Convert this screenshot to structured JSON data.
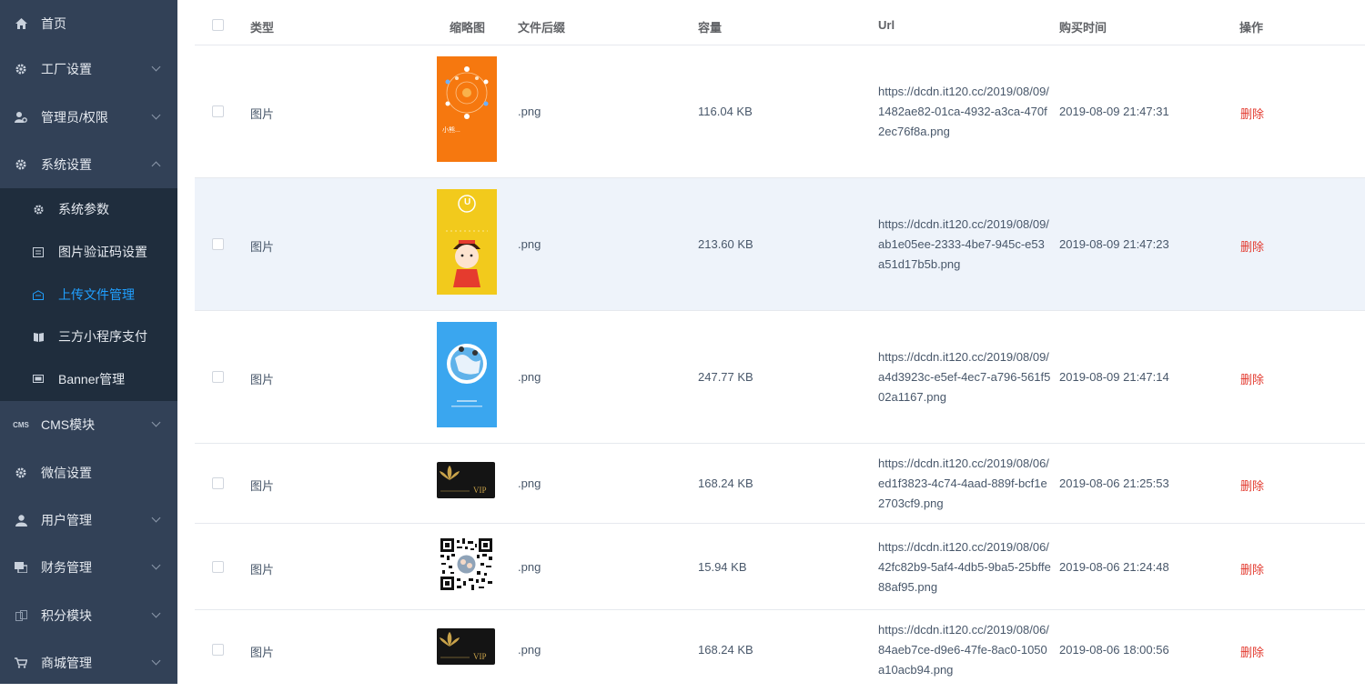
{
  "sidebar": {
    "items": [
      {
        "label": "首页",
        "icon": "home-icon"
      },
      {
        "label": "工厂设置",
        "icon": "gear-icon"
      },
      {
        "label": "管理员/权限",
        "icon": "admin-icon"
      },
      {
        "label": "系统设置",
        "icon": "gear-icon"
      },
      {
        "label": "CMS模块",
        "icon": "cms-icon"
      },
      {
        "label": "微信设置",
        "icon": "gear-icon"
      },
      {
        "label": "用户管理",
        "icon": "user-icon"
      },
      {
        "label": "财务管理",
        "icon": "finance-icon"
      },
      {
        "label": "积分模块",
        "icon": "points-icon"
      },
      {
        "label": "商城管理",
        "icon": "shop-icon"
      }
    ],
    "cms_icon_text": "CMS",
    "submenu": [
      {
        "label": "系统参数",
        "icon": "gear-icon"
      },
      {
        "label": "图片验证码设置",
        "icon": "captcha-icon"
      },
      {
        "label": "上传文件管理",
        "icon": "upload-icon",
        "active": true
      },
      {
        "label": "三方小程序支付",
        "icon": "book-icon"
      },
      {
        "label": "Banner管理",
        "icon": "banner-icon"
      }
    ]
  },
  "colors": {
    "sidebar_bg": "#324157",
    "submenu_bg": "#1f2d3d",
    "active": "#20a0ff",
    "delete": "#e33a2f"
  },
  "table": {
    "headers": {
      "type": "类型",
      "thumb": "缩略图",
      "ext": "文件后缀",
      "size": "容量",
      "url": "Url",
      "time": "购买时间",
      "action": "操作"
    },
    "rows": [
      {
        "type": "图片",
        "thumb": "orange-poster",
        "ext": ".png",
        "size": "116.04 KB",
        "url": "https://dcdn.it120.cc/2019/08/09/1482ae82-01ca-4932-a3ca-470f2ec76f8a.png",
        "time": "2019-08-09 21:47:31",
        "action": "删除",
        "thumb_text": "小熊..."
      },
      {
        "type": "图片",
        "thumb": "yellow-cartoon",
        "ext": ".png",
        "size": "213.60 KB",
        "url": "https://dcdn.it120.cc/2019/08/09/ab1e05ee-2333-4be7-945c-e53a51d17b5b.png",
        "time": "2019-08-09 21:47:23",
        "action": "删除",
        "thumb_text": "U"
      },
      {
        "type": "图片",
        "thumb": "blue-globe",
        "ext": ".png",
        "size": "247.77 KB",
        "url": "https://dcdn.it120.cc/2019/08/09/a4d3923c-e5ef-4ec7-a796-561f502a1167.png",
        "time": "2019-08-09 21:47:14",
        "action": "删除"
      },
      {
        "type": "图片",
        "thumb": "vip-card",
        "ext": ".png",
        "size": "168.24 KB",
        "url": "https://dcdn.it120.cc/2019/08/06/ed1f3823-4c74-4aad-889f-bcf1e2703cf9.png",
        "time": "2019-08-06 21:25:53",
        "action": "删除",
        "thumb_text": "VIP"
      },
      {
        "type": "图片",
        "thumb": "qr-code",
        "ext": ".png",
        "size": "15.94 KB",
        "url": "https://dcdn.it120.cc/2019/08/06/42fc82b9-5af4-4db5-9ba5-25bffe88af95.png",
        "time": "2019-08-06 21:24:48",
        "action": "删除"
      },
      {
        "type": "图片",
        "thumb": "vip-card",
        "ext": ".png",
        "size": "168.24 KB",
        "url": "https://dcdn.it120.cc/2019/08/06/84aeb7ce-d9e6-47fe-8ac0-1050a10acb94.png",
        "time": "2019-08-06 18:00:56",
        "action": "删除",
        "thumb_text": "VIP"
      }
    ]
  }
}
